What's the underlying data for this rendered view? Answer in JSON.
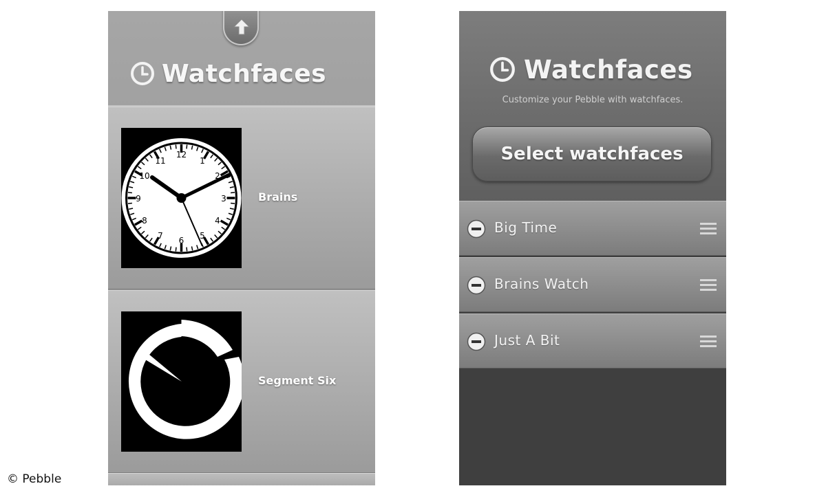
{
  "left_screen": {
    "title": "Watchfaces",
    "icons": {
      "header": "clock-icon",
      "top_tab": "up-arrow-icon"
    },
    "watchfaces": [
      {
        "name": "Brains",
        "thumbnail": "analog-clock"
      },
      {
        "name": "Segment Six",
        "thumbnail": "segment-six"
      }
    ]
  },
  "right_screen": {
    "title": "Watchfaces",
    "subtitle": "Customize your Pebble with watchfaces.",
    "select_button_label": "Select watchfaces",
    "icons": {
      "header": "clock-icon",
      "remove": "minus-circle-icon",
      "reorder": "drag-handle-icon"
    },
    "watchfaces": [
      {
        "name": "Big Time"
      },
      {
        "name": "Brains Watch"
      },
      {
        "name": "Just A Bit"
      }
    ]
  },
  "credit": "© Pebble",
  "colors": {
    "left_background": "#a6a6a6",
    "right_header": "#6e6e6e",
    "right_body": "#3f3f3f",
    "text": "#f5f5f5"
  }
}
